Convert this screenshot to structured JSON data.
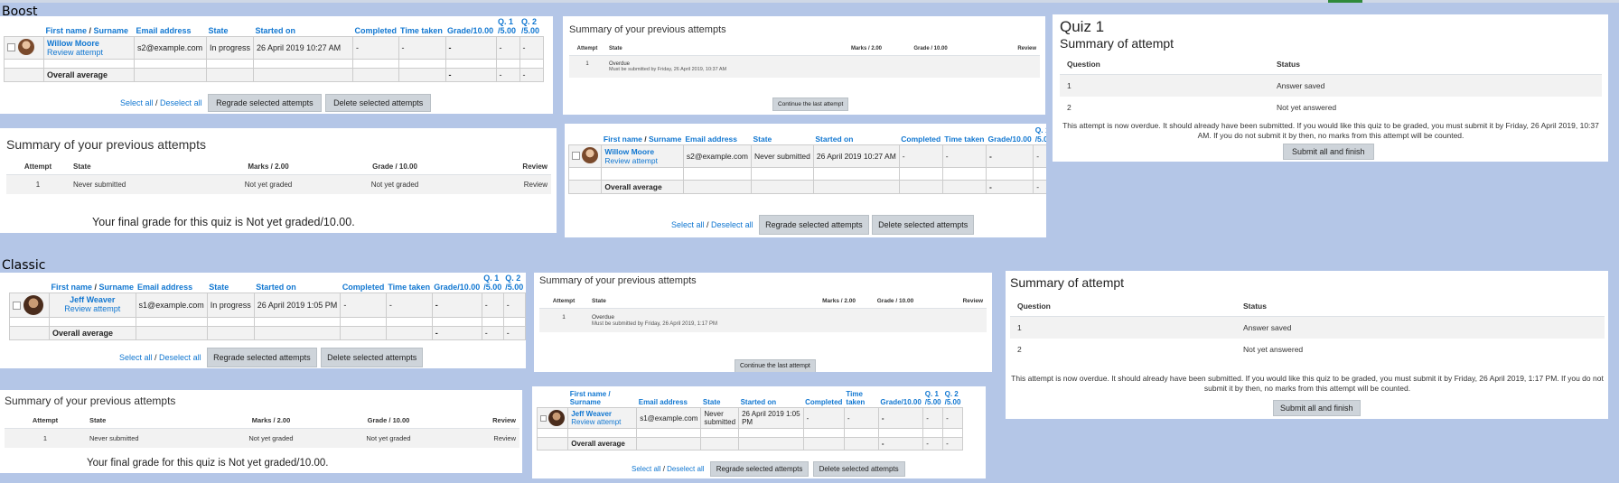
{
  "sections": {
    "boost": "Boost",
    "classic": "Classic"
  },
  "grading_headers": {
    "firstname": "First name",
    "slash": " / ",
    "surname": "Surname",
    "email": "Email address",
    "state": "State",
    "started": "Started on",
    "completed": "Completed",
    "timetaken": "Time taken",
    "grade": "Grade/10.00",
    "q1_top": "Q. 1",
    "q1_bottom": "/5.00",
    "q2_top": "Q. 2",
    "q2_bottom": "/5.00",
    "time_top": "Time",
    "time_bottom": "taken",
    "firstname_split": "First name /",
    "surname_split": "Surname"
  },
  "grading_common": {
    "review_attempt": "Review attempt",
    "overall_average": "Overall average",
    "dash": "-",
    "select_all": "Select all",
    "deselect_all": "Deselect all",
    "regrade": "Regrade selected attempts",
    "delete": "Delete selected attempts"
  },
  "boost_grades_1": {
    "name": "Willow Moore",
    "email": "s2@example.com",
    "state": "In progress",
    "started": "26 April 2019 10:27 AM"
  },
  "boost_grades_2": {
    "name": "Willow Moore",
    "email": "s2@example.com",
    "state": "Never submitted",
    "started": "26 April 2019 10:27 AM"
  },
  "classic_grades_1": {
    "name": "Jeff Weaver",
    "email": "s1@example.com",
    "state": "In progress",
    "started": "26 April 2019 1:05 PM"
  },
  "classic_grades_2": {
    "name": "Jeff Weaver",
    "email": "s1@example.com",
    "state_a": "Never",
    "state_b": "submitted",
    "started_a": "26 April 2019 1:05",
    "started_b": "PM"
  },
  "attempts_headers": {
    "attempt": "Attempt",
    "state": "State",
    "marks": "Marks / 2.00",
    "grade": "Grade / 10.00",
    "review": "Review"
  },
  "attempts_common": {
    "title": "Summary of your previous attempts",
    "attempt_no": "1",
    "overdue": "Overdue",
    "never_submitted": "Never submitted",
    "not_yet_graded": "Not yet graded",
    "review": "Review",
    "continue": "Continue the last attempt",
    "final": "Your final grade for this quiz is Not yet graded/10.00."
  },
  "boost_attempts_overdue": {
    "deadline": "Must be submitted by Friday, 26 April 2019, 10:37 AM"
  },
  "classic_attempts_overdue": {
    "deadline": "Must be submitted by Friday, 26 April 2019, 1:17 PM"
  },
  "quiz_common": {
    "summary_title": "Summary of attempt",
    "question": "Question",
    "status": "Status",
    "q1": "1",
    "q2": "2",
    "answer_saved": "Answer saved",
    "not_yet_answered": "Not yet answered",
    "submit": "Submit all and finish"
  },
  "boost_quiz": {
    "title": "Quiz 1",
    "overdue_text": "This attempt is now overdue. It should already have been submitted. If you would like this quiz to be graded, you must submit it by Friday, 26 April 2019, 10:37 AM. If you do not submit it by then, no marks from this attempt will be counted."
  },
  "classic_quiz": {
    "overdue_text": "This attempt is now overdue. It should already have been submitted. If you would like this quiz to be graded, you must submit it by Friday, 26 April 2019, 1:17 PM. If you do not submit it by then, no marks from this attempt will be counted."
  },
  "colors": {
    "link": "#1177d1",
    "background": "#b4c6e7",
    "button": "#ced4da",
    "stripe": "#f2f2f2"
  }
}
